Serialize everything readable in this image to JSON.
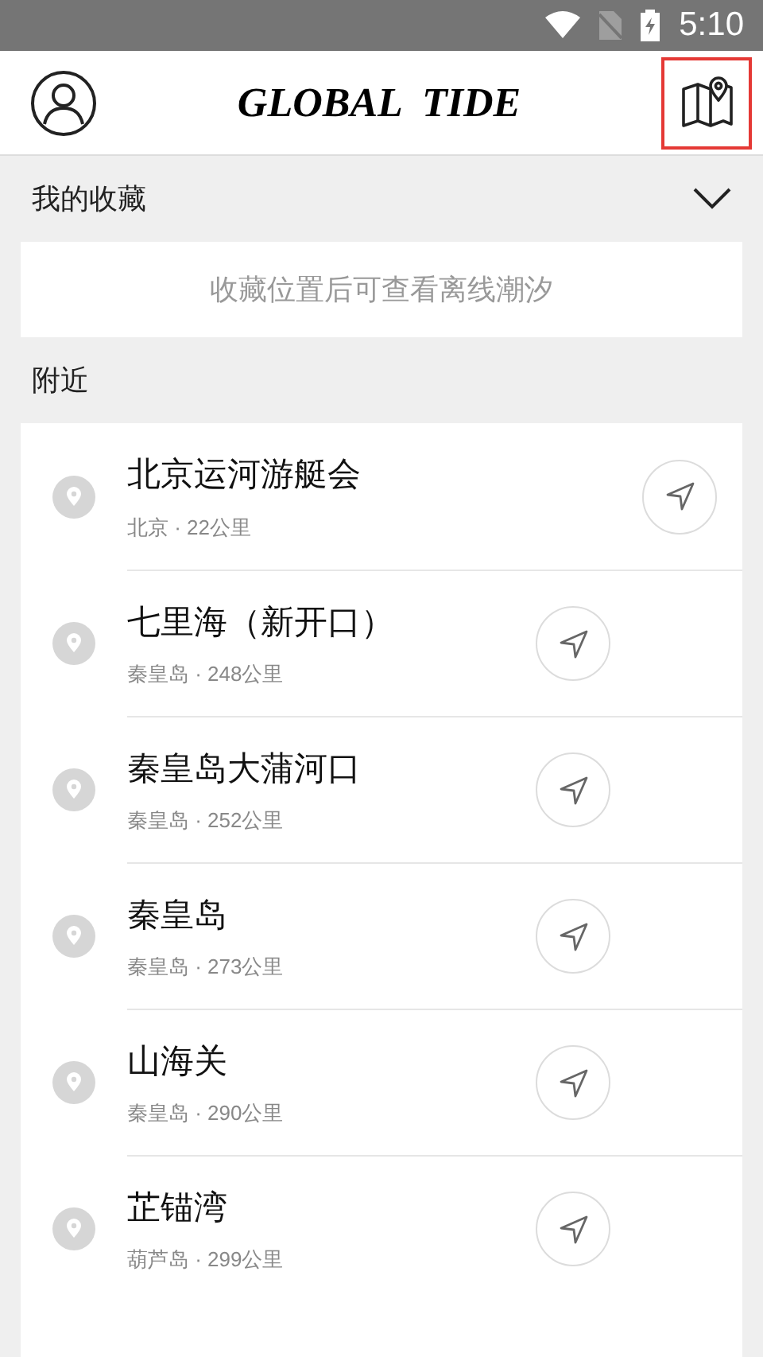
{
  "status_bar": {
    "time": "5:10"
  },
  "header": {
    "title": "GLOBAL  TIDE",
    "map_button_highlighted": true
  },
  "favorites": {
    "title": "我的收藏",
    "expanded": true,
    "empty_text": "收藏位置后可查看离线潮汐"
  },
  "nearby": {
    "title": "附近",
    "items": [
      {
        "name": "北京运河游艇会",
        "detail": "北京 · 22公里"
      },
      {
        "name": "七里海（新开口）",
        "detail": "秦皇岛 · 248公里"
      },
      {
        "name": "秦皇岛大蒲河口",
        "detail": "秦皇岛 · 252公里"
      },
      {
        "name": "秦皇岛",
        "detail": "秦皇岛 · 273公里"
      },
      {
        "name": "山海关",
        "detail": "秦皇岛 · 290公里"
      },
      {
        "name": "芷锚湾",
        "detail": "葫芦岛 · 299公里"
      }
    ]
  }
}
